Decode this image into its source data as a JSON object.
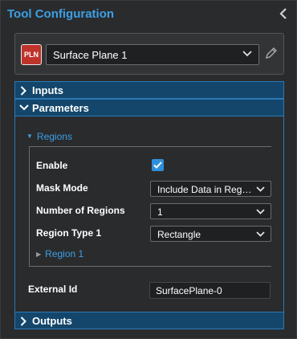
{
  "panel": {
    "title": "Tool Configuration"
  },
  "tool": {
    "badge": "PLN",
    "selected": "Surface Plane 1"
  },
  "sections": {
    "inputs": "Inputs",
    "parameters": "Parameters",
    "outputs": "Outputs"
  },
  "regions": {
    "label": "Regions",
    "enable_label": "Enable",
    "enable_checked": true,
    "mask_mode_label": "Mask Mode",
    "mask_mode_value": "Include Data in Region",
    "num_regions_label": "Number of Regions",
    "num_regions_value": "1",
    "region_type_label": "Region Type 1",
    "region_type_value": "Rectangle",
    "region1_label": "Region 1"
  },
  "external_id": {
    "label": "External Id",
    "value": "SurfacePlane-0"
  },
  "colors": {
    "accent": "#3ba0e6",
    "header_bg": "#14466b",
    "badge_bg": "#c0332b",
    "checkbox": "#2f8fdc"
  },
  "icons": {
    "collapse": "chevron-left-icon",
    "select_chevron": "chevron-down-icon",
    "edit": "pencil-icon",
    "section_collapsed": "chevron-right-icon",
    "section_expanded": "chevron-down-icon",
    "check": "check-icon"
  }
}
